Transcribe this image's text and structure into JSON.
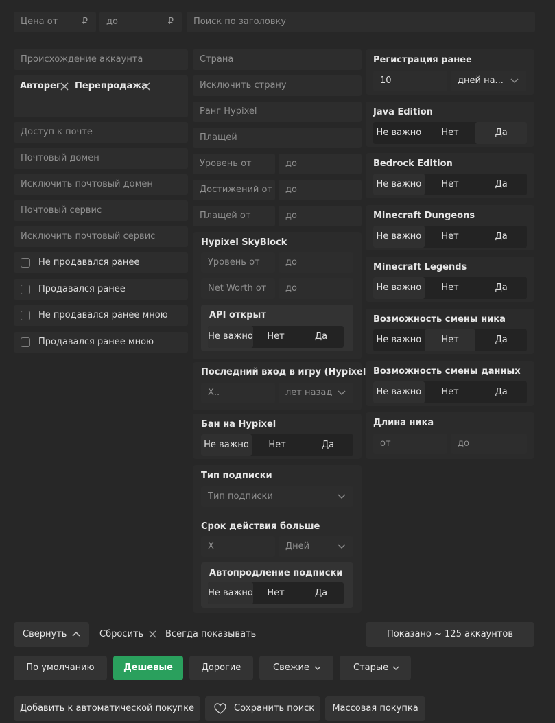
{
  "top": {
    "price_from": "Цена от",
    "price_to": "до",
    "currency": "₽",
    "title_search": "Поиск по заголовку"
  },
  "col1": {
    "origin_placeholder": "Происхождение аккаунта",
    "origin_tags": [
      "Авторег",
      "Перепродажа"
    ],
    "mail_access": "Доступ к почте",
    "mail_domain": "Почтовый домен",
    "exclude_mail_domain": "Исключить почтовый домен",
    "mail_service": "Почтовый сервис",
    "exclude_mail_service": "Исключить почтовый сервис",
    "checkboxes": [
      "Не продавался ранее",
      "Продавался ранее",
      "Не продавался ранее мною",
      "Продавался ранее мною"
    ]
  },
  "col2": {
    "country": "Страна",
    "exclude_country": "Исключить страну",
    "hypixel_rank": "Ранг Hypixel",
    "capes": "Плащей",
    "level_from": "Уровень от",
    "achievements_from": "Достижений от",
    "capes_from": "Плащей от",
    "to": "до",
    "skyblock": {
      "title": "Hypixel SkyBlock",
      "level_from": "Уровень от",
      "networth_from": "Net Worth от",
      "to": "до",
      "api_title": "API открыт",
      "api_options": [
        "Не важно",
        "Нет",
        "Да"
      ]
    },
    "last_login": {
      "title": "Последний вход в игру (Hypixel)",
      "value_placeholder": "X..",
      "unit": "лет назад"
    },
    "ban": {
      "title": "Бан на Hypixel",
      "options": [
        "Не важно",
        "Нет",
        "Да"
      ]
    },
    "subscription": {
      "title": "Тип подписки",
      "placeholder": "Тип подписки",
      "duration_title": "Срок действия больше",
      "duration_placeholder": "X",
      "duration_unit": "Дней",
      "autorenew_title": "Автопродление подписки",
      "autorenew_options": [
        "Не важно",
        "Нет",
        "Да"
      ]
    }
  },
  "col3": {
    "registration": {
      "title": "Регистрация ранее",
      "value": "10",
      "unit": "дней на..."
    },
    "java": {
      "title": "Java Edition",
      "options": [
        "Не важно",
        "Нет",
        "Да"
      ]
    },
    "bedrock": {
      "title": "Bedrock Edition",
      "options": [
        "Не важно",
        "Нет",
        "Да"
      ]
    },
    "dungeons": {
      "title": "Minecraft Dungeons",
      "options": [
        "Не важно",
        "Нет",
        "Да"
      ]
    },
    "legends": {
      "title": "Minecraft Legends",
      "options": [
        "Не важно",
        "Нет",
        "Да"
      ]
    },
    "nick_change": {
      "title": "Возможность смены ника",
      "options": [
        "Не важно",
        "Нет",
        "Да"
      ]
    },
    "data_change": {
      "title": "Возможность смены данных",
      "options": [
        "Не важно",
        "Нет",
        "Да"
      ]
    },
    "nick_length": {
      "title": "Длина ника",
      "from": "от",
      "to": "до"
    }
  },
  "footer": {
    "collapse": "Свернуть",
    "reset": "Сбросить",
    "always_show": "Всегда показывать",
    "shown": "Показано ~ 125 аккаунтов",
    "sort": [
      "По умолчанию",
      "Дешевые",
      "Дорогие",
      "Свежие",
      "Старые"
    ],
    "add_auto": "Добавить к автоматической покупке",
    "save_search": "Сохранить поиск",
    "bulk_buy": "Массовая покупка"
  },
  "colors": {
    "accent": "#2aa05d",
    "background": "#272727",
    "field": "#2d2d2d"
  }
}
